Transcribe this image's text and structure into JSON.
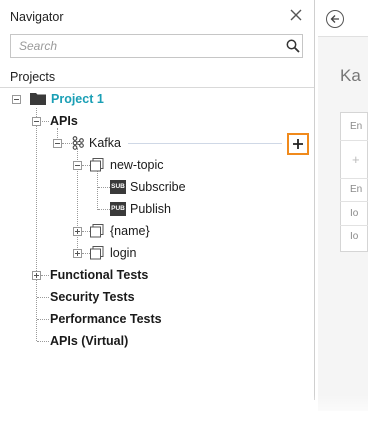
{
  "navigator": {
    "title": "Navigator",
    "search": {
      "placeholder": "Search",
      "value": ""
    },
    "projects_label": "Projects",
    "tree": {
      "project": "Project 1",
      "apis": "APIs",
      "kafka": "Kafka",
      "new_topic": "new-topic",
      "subscribe": "Subscribe",
      "subscribe_badge": "SUB",
      "publish": "Publish",
      "publish_badge": "PUB",
      "name_param": "{name}",
      "login": "login",
      "functional_tests": "Functional Tests",
      "security_tests": "Security Tests",
      "performance_tests": "Performance Tests",
      "apis_virtual": "APIs (Virtual)"
    },
    "add_button_label": "+"
  },
  "right_panel": {
    "title_partial": "Ka",
    "box_header_partial": "En",
    "rows_partial": [
      "En",
      "Io",
      "Io"
    ]
  },
  "colors": {
    "project_teal": "#1a9fb5",
    "add_highlight": "#f08a1c"
  }
}
